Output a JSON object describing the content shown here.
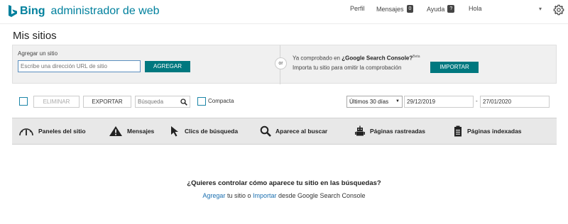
{
  "brand": {
    "word": "Bing",
    "title": "administrador de web"
  },
  "nav": {
    "perfil": "Perfil",
    "mensajes": "Mensajes",
    "mensajes_count": "0",
    "ayuda": "Ayuda",
    "ayuda_badge": "?",
    "hola": "Hola"
  },
  "page": {
    "title": "Mis sitios"
  },
  "add_site": {
    "label": "Agregar un sitio",
    "placeholder": "Escribe una dirección URL de sitio",
    "button": "AGREGAR",
    "or": "or"
  },
  "import": {
    "prefix": "Ya comprobado en ",
    "service": "¿Google Search Console?",
    "beta": "Beta",
    "description": "Importa tu sitio para omitir la comprobación",
    "button": "IMPORTAR"
  },
  "toolbar": {
    "delete": "ELIMINAR",
    "export": "EXPORTAR",
    "search_placeholder": "Búsqueda",
    "compact": "Compacta",
    "range": "Últimos 30 días",
    "date_from": "29/12/2019",
    "date_sep": "-",
    "date_to": "27/01/2020"
  },
  "tabs": [
    {
      "label": "Paneles del sitio",
      "icon": "gauge-icon"
    },
    {
      "label": "Mensajes",
      "icon": "warning-icon"
    },
    {
      "label": "Clics de búsqueda",
      "icon": "cursor-icon"
    },
    {
      "label": "Aparece al buscar",
      "icon": "magnifier-icon"
    },
    {
      "label": "Páginas rastreadas",
      "icon": "robot-icon"
    },
    {
      "label": "Páginas indexadas",
      "icon": "clipboard-icon"
    }
  ],
  "empty": {
    "question": "¿Quieres controlar cómo aparece tu sitio en las búsquedas?",
    "link_add": "Agregar",
    "text_mid": " tu sitio o ",
    "link_import": "Importar",
    "text_end": " desde Google Search Console"
  },
  "colors": {
    "brand": "#00809d",
    "button": "#00787f",
    "link": "#1a6fb0"
  }
}
